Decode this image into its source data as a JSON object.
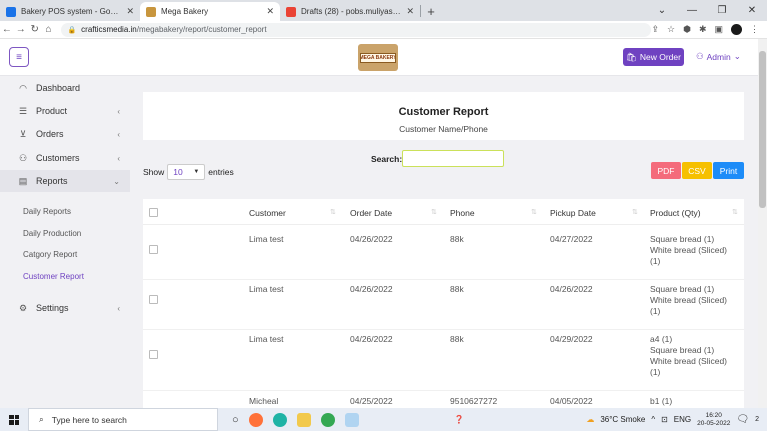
{
  "browser": {
    "tabs": [
      {
        "label": "Bakery POS system - Google Do",
        "icon_color": "#1a73e8"
      },
      {
        "label": "Mega Bakery",
        "icon_color": "#c8963e"
      },
      {
        "label": "Drafts (28) - pobs.muliyashiya@g",
        "icon_color": "#ea4335"
      }
    ],
    "url_host": "crafticsmedia.in",
    "url_path": "/megabakery/report/customer_report"
  },
  "header": {
    "logo_text": "MEGA BAKERY",
    "new_order_label": "New Order",
    "admin_label": "Admin"
  },
  "sidebar": {
    "items": [
      {
        "label": "Dashboard",
        "icon": "gauge-icon"
      },
      {
        "label": "Product",
        "icon": "list-icon"
      },
      {
        "label": "Orders",
        "icon": "cart-icon"
      },
      {
        "label": "Customers",
        "icon": "user-icon"
      },
      {
        "label": "Reports",
        "icon": "file-icon"
      },
      {
        "label": "Settings",
        "icon": "gear-icon"
      }
    ],
    "reports_sub": [
      "Daily Reports",
      "Daily Production",
      "Catgory Report",
      "Customer Report"
    ]
  },
  "report": {
    "title": "Customer Report",
    "subtitle": "Customer Name/Phone",
    "show_label": "Show",
    "entries_value": "10",
    "entries_label": "entries",
    "search_label": "Search:",
    "buttons": {
      "pdf": "PDF",
      "csv": "CSV",
      "print": "Print"
    }
  },
  "table": {
    "columns": [
      "Customer",
      "Order Date",
      "Phone",
      "Pickup Date",
      "Product (Qty)"
    ],
    "rows": [
      {
        "customer": "Lima test",
        "order_date": "04/26/2022",
        "phone": "88k",
        "pickup_date": "04/27/2022",
        "products": [
          "Square bread (1)",
          "White bread (Sliced)",
          "(1)"
        ]
      },
      {
        "customer": "Lima test",
        "order_date": "04/26/2022",
        "phone": "88k",
        "pickup_date": "04/26/2022",
        "products": [
          "Square bread (1)",
          "White bread (Sliced)",
          "(1)"
        ]
      },
      {
        "customer": "Lima test",
        "order_date": "04/26/2022",
        "phone": "88k",
        "pickup_date": "04/29/2022",
        "products": [
          "a4 (1)",
          "Square bread (1)",
          "White bread (Sliced)",
          "(1)"
        ]
      },
      {
        "customer": "Micheal",
        "order_date": "04/25/2022",
        "phone": "9510627272",
        "pickup_date": "04/05/2022",
        "products": [
          "b1 (1)"
        ]
      }
    ]
  },
  "taskbar": {
    "search_placeholder": "Type here to search",
    "weather": "36°C  Smoke",
    "lang": "ENG",
    "time": "16:20",
    "date": "20-05-2022",
    "notif_count": "2"
  },
  "colors": {
    "accent": "#6f42c1",
    "pdf": "#f46b7b",
    "csv": "#f6c000",
    "print": "#1d8cf8"
  }
}
